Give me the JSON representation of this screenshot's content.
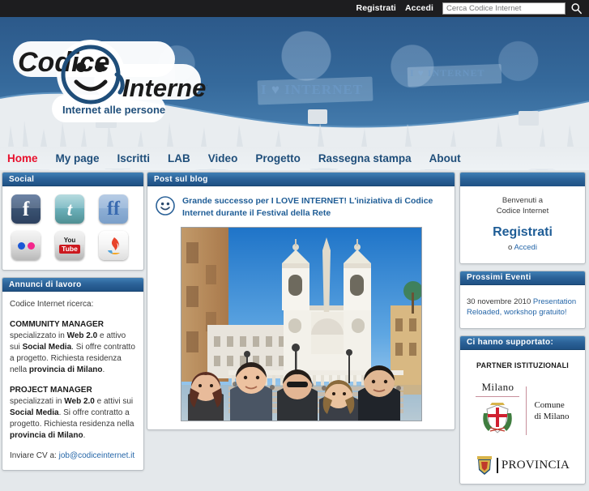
{
  "topbar": {
    "register_label": "Registrati",
    "login_label": "Accedi",
    "search_placeholder": "Cerca Codice Internet",
    "search_value": "",
    "search_icon": "search-icon"
  },
  "header": {
    "logo_word1": "Codice",
    "logo_word2": "Internet",
    "logo_tagline": "Internet alle persone",
    "banner_sign_text": "I ♥ INTERNET"
  },
  "nav": {
    "items": [
      {
        "label": "Home",
        "active": true
      },
      {
        "label": "My page",
        "active": false
      },
      {
        "label": "Iscritti",
        "active": false
      },
      {
        "label": "LAB",
        "active": false
      },
      {
        "label": "Video",
        "active": false
      },
      {
        "label": "Progetto",
        "active": false
      },
      {
        "label": "Rassegna stampa",
        "active": false
      },
      {
        "label": "About",
        "active": false
      }
    ]
  },
  "sidebar_left": {
    "social": {
      "title": "Social",
      "icons": [
        {
          "name": "facebook-icon",
          "glyph": "f"
        },
        {
          "name": "twitter-icon",
          "glyph": "t"
        },
        {
          "name": "friendfeed-icon",
          "glyph": "ff"
        },
        {
          "name": "flickr-icon",
          "glyph": ""
        },
        {
          "name": "youtube-icon",
          "glyph_top": "You",
          "glyph_bottom": "Tube"
        },
        {
          "name": "flame-icon",
          "glyph": ""
        }
      ]
    },
    "jobs": {
      "title": "Annunci di lavoro",
      "intro": "Codice Internet ricerca:",
      "ad1_role": "COMMUNITY MANAGER",
      "ad1_t1": " specializzato in ",
      "ad1_b1": "Web 2.0",
      "ad1_t2": " e attivo sui ",
      "ad1_b2": "Social Media",
      "ad1_t3": ". Si offre contratto a progetto. Richiesta residenza nella ",
      "ad1_b3": "provincia di Milano",
      "ad1_t4": ".",
      "ad2_role": "PROJECT MANAGER",
      "ad2_t1": " specializzati in ",
      "ad2_b1": "Web 2.0",
      "ad2_t2": " e attivi sui ",
      "ad2_b2": "Social Media",
      "ad2_t3": ". Si offre contratto a progetto. Richiesta residenza nella ",
      "ad2_b3": "provincia di Milano",
      "ad2_t4": ".",
      "cv_label": "Inviare CV a: ",
      "cv_email": "job@codiceinternet.it"
    }
  },
  "main": {
    "blog": {
      "title": "Post sul blog",
      "avatar_icon": "smiley-avatar-icon",
      "post_title": "Grande successo per I LOVE INTERNET! L'iniziativa di Codice Internet durante il Festival della Rete",
      "photo_alt": "Gruppo di persone sulla scalinata di Trinità dei Monti a Roma"
    }
  },
  "sidebar_right": {
    "welcome": {
      "line1": "Benvenuti a",
      "line2": "Codice Internet",
      "register_label": "Registrati",
      "or_label": "o ",
      "login_label": "Accedi"
    },
    "events": {
      "title": "Prossimi Eventi",
      "date": "30 novembre 2010 ",
      "link": "Presentation Reloaded, workshop gratuito!"
    },
    "supporters": {
      "title": "Ci hanno supportato:",
      "partner_label": "PARTNER ISTITUZIONALI",
      "milano_word": "Milano",
      "milano_sub_l1": "Comune",
      "milano_sub_l2": "di Milano",
      "provincia_word": "PROVINCIA"
    }
  },
  "colors": {
    "topbar_bg": "#1d1d1f",
    "panel_header": "#2b6298",
    "accent_blue": "#1f5d96",
    "active_nav": "#e8112d",
    "link_blue": "#2566a8",
    "page_bg": "#e4e8eb"
  }
}
